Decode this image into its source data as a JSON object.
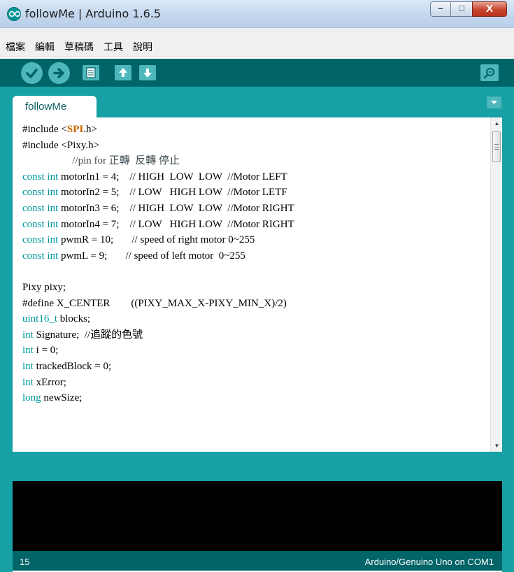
{
  "window": {
    "title": "followMe | Arduino 1.6.5",
    "minimize_glyph": "–",
    "maximize_glyph": "□",
    "close_glyph": "X"
  },
  "menu": {
    "items": [
      "檔案",
      "編輯",
      "草稿碼",
      "工具",
      "說明"
    ]
  },
  "toolbar": {
    "buttons": [
      "verify-icon",
      "upload-icon",
      "new-icon",
      "open-icon",
      "save-icon"
    ],
    "serial_monitor_icon": "serial-monitor-icon"
  },
  "tabs": [
    {
      "label": "followMe",
      "active": true
    }
  ],
  "editor": {
    "lines": [
      {
        "pre": "#include <",
        "lib": "SPI",
        "post": ".h>"
      },
      {
        "pre": "#include <Pixy.h>"
      },
      {
        "pre": "                   //pin for 正轉  反轉 停止"
      },
      {
        "kw": "const int",
        "pre": " motorIn1 = 4;    // HIGH  LOW  LOW  //Motor LEFT"
      },
      {
        "kw": "const int",
        "pre": " motorIn2 = 5;    // LOW   HIGH LOW  //Motor LETF"
      },
      {
        "kw": "const int",
        "pre": " motorIn3 = 6;    // HIGH  LOW  LOW  //Motor RIGHT"
      },
      {
        "kw": "const int",
        "pre": " motorIn4 = 7;    // LOW   HIGH LOW  //Motor RIGHT"
      },
      {
        "kw": "const int",
        "pre": " pwmR = 10;       // speed of right motor 0~255"
      },
      {
        "kw": "const int",
        "pre": " pwmL = 9;       // speed of left motor  0~255"
      },
      {
        "pre": ""
      },
      {
        "pre": "Pixy pixy;"
      },
      {
        "pre": "#define X_CENTER        ((PIXY_MAX_X-PIXY_MIN_X)/2)"
      },
      {
        "kw": "uint16_t",
        "pre": " blocks;"
      },
      {
        "kw": "int",
        "pre": " Signature;  //追蹤的色號"
      },
      {
        "kw": "int",
        "pre": " i = 0;"
      },
      {
        "kw": "int",
        "pre": " trackedBlock = 0;"
      },
      {
        "kw": "int",
        "pre": " xError;"
      },
      {
        "kw": "long",
        "pre": " newSize;"
      }
    ]
  },
  "status": {
    "line_number": "15",
    "board": "Arduino/Genuino Uno on COM1"
  },
  "colors": {
    "toolbar": "#006468",
    "accent": "#17a1a5",
    "button": "#4db7bb",
    "keyword": "#00979c",
    "library": "#cc6600"
  }
}
